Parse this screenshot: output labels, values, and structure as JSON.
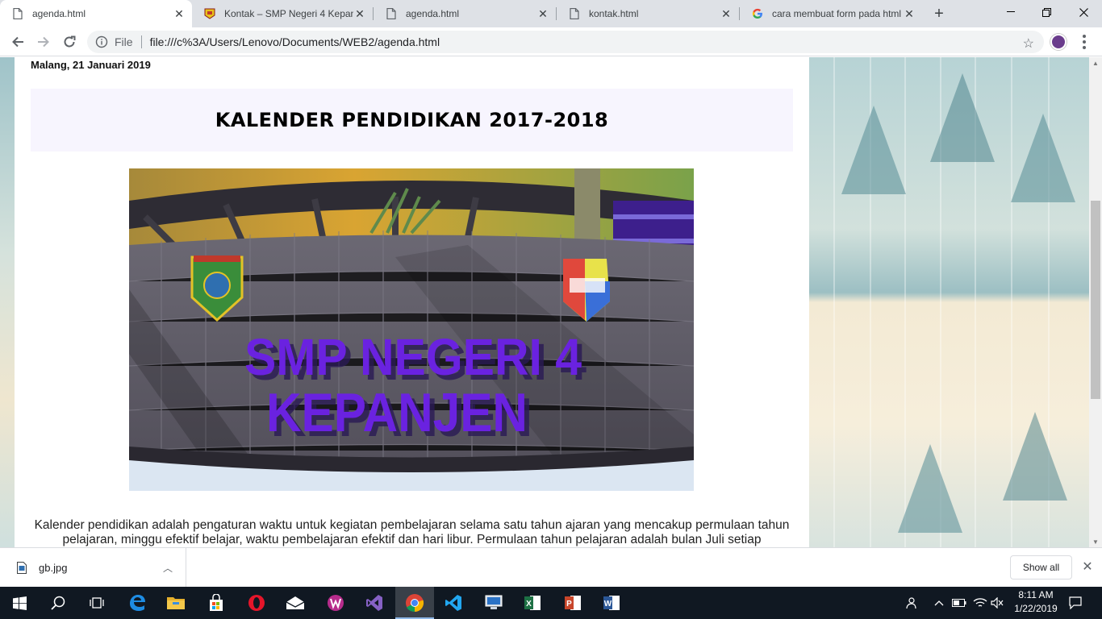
{
  "browser": {
    "tabs": [
      {
        "title": "agenda.html",
        "icon": "page-icon",
        "active": true
      },
      {
        "title": "Kontak – SMP Negeri 4 Kepanj",
        "icon": "school-favicon",
        "active": false
      },
      {
        "title": "agenda.html",
        "icon": "page-icon",
        "active": false
      },
      {
        "title": "kontak.html",
        "icon": "page-icon",
        "active": false
      },
      {
        "title": "cara membuat form pada html",
        "icon": "google-icon",
        "active": false
      }
    ],
    "omnibox": {
      "scheme_label": "File",
      "url": "file:///c%3A/Users/Lenovo/Documents/WEB2/agenda.html"
    }
  },
  "page": {
    "date": "Malang, 21 Januari 2019",
    "heading": "KALENDER PENDIDIKAN 2017-2018",
    "image_sign_line1": "SMP NEGERI 4",
    "image_sign_line2": "KEPANJEN",
    "paragraph": "Kalender pendidikan adalah pengaturan waktu untuk kegiatan pembelajaran selama satu tahun ajaran yang mencakup permulaan tahun pelajaran, minggu efektif belajar, waktu pembelajaran efektif dan hari libur. Permulaan tahun pelajaran adalah bulan Juli setiap"
  },
  "downloads": {
    "file_name": "gb.jpg",
    "show_all_label": "Show all"
  },
  "taskbar": {
    "time": "8:11 AM",
    "date": "1/22/2019"
  },
  "colors": {
    "tabbar_bg": "#dee1e6",
    "banner_bg": "#f7f5fe",
    "sign_text": "#6a22e0",
    "taskbar_bg": "#101822"
  }
}
